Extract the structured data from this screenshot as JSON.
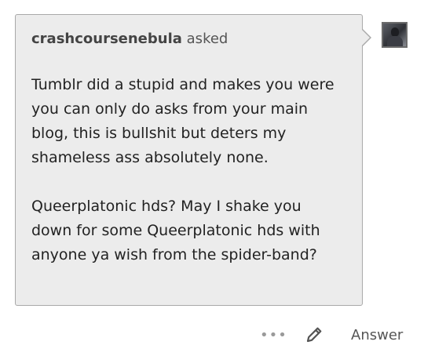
{
  "ask": {
    "asker": "crashcoursenebula",
    "verb": "asked",
    "paragraphs": [
      "Tumblr did a stupid and makes you were you can only do asks from your main blog, this is bullshit but deters my shameless ass absolutely none.",
      "Queerplatonic hds? May I shake you down for some Queerplatonic hds with anyone ya wish from the spider-band?"
    ]
  },
  "avatar": {
    "icon": "user-avatar"
  },
  "actions": {
    "more_icon": "•••",
    "edit_icon": "pencil-icon",
    "answer_label": "Answer"
  },
  "colors": {
    "bubble_bg": "#ececec",
    "bubble_border": "#a9a9a9",
    "text": "#222222",
    "muted": "#555555"
  }
}
